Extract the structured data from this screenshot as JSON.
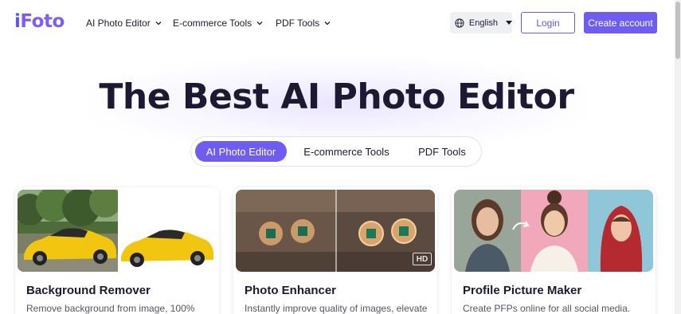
{
  "brand": {
    "logo_part1": "i",
    "logo_part2": "Foto"
  },
  "nav": {
    "items": [
      {
        "label": "AI Photo Editor"
      },
      {
        "label": "E-commerce Tools"
      },
      {
        "label": "PDF Tools"
      }
    ],
    "language": "English",
    "login": "Login",
    "create_account": "Create account"
  },
  "hero": {
    "title": "The Best AI Photo Editor",
    "tabs": [
      {
        "label": "AI Photo Editor",
        "active": true
      },
      {
        "label": "E-commerce Tools",
        "active": false
      },
      {
        "label": "PDF Tools",
        "active": false
      }
    ]
  },
  "cards": [
    {
      "title": "Background Remover",
      "desc": "Remove background from image, 100%"
    },
    {
      "title": "Photo Enhancer",
      "desc": "Instantly improve quality of images, elevate",
      "badge": "HD"
    },
    {
      "title": "Profile Picture Maker",
      "desc": "Create PFPs online for all social media."
    }
  ],
  "colors": {
    "accent": "#6f5cf1",
    "text": "#1c1a33",
    "muted": "#555566"
  }
}
